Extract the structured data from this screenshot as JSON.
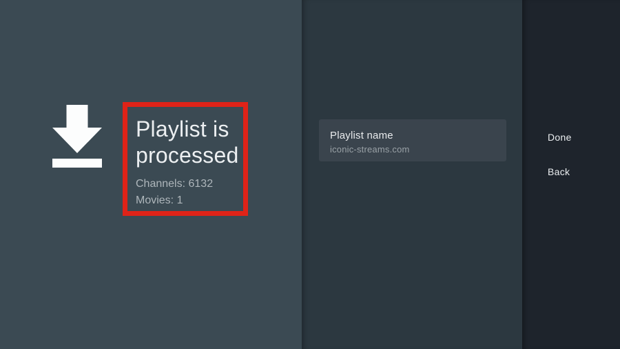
{
  "colors": {
    "left_bg": "#3b4a53",
    "middle_bg": "#2c3840",
    "right_bg": "#1e242c",
    "card_bg": "#3a444d",
    "annotation_red": "#df2318",
    "text_primary": "#eceff1",
    "text_secondary": "#aeb6bb",
    "card_title": "#e9ebed",
    "card_subtitle": "#9aa2a7",
    "icon_white": "#fcfdfd"
  },
  "status": {
    "icon": "download-icon",
    "title": "Playlist is processed",
    "channels_label": "Channels: 6132",
    "movies_label": "Movies: 1"
  },
  "playlist_card": {
    "name_label": "Playlist name",
    "value": "iconic-streams.com"
  },
  "actions": {
    "done_label": "Done",
    "back_label": "Back"
  }
}
